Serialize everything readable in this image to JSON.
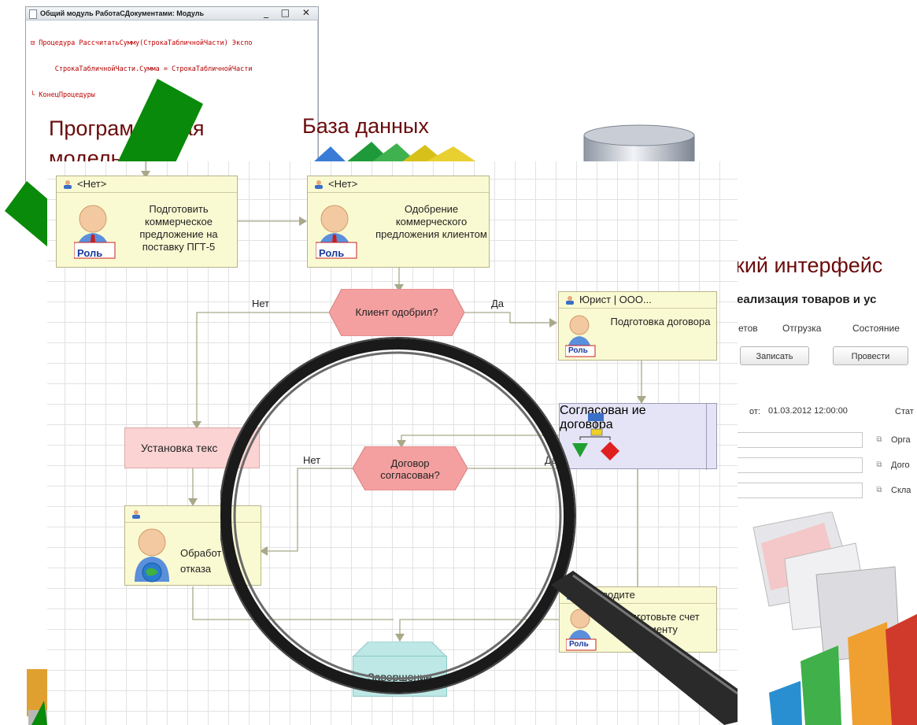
{
  "code_window": {
    "title": "Общий модуль РаботаСДокументами: Модуль",
    "window_buttons": "_ □ ✕",
    "lines": [
      "⊟ Процедура РассчитатьСумму(СтрокаТабличнойЧасти) Экспо",
      "      СтрокаТабличнойЧасти.Сумма = СтрокаТабличнойЧасти",
      "└ КонецПроцедуры"
    ]
  },
  "labels": {
    "program_model_1": "Програм",
    "program_model_2": "ая",
    "program_model_3": "модель",
    "database": "База данных",
    "user_interface": "кий интерфейс"
  },
  "diagram": {
    "node_nobody_1": {
      "header": "<Нет>",
      "text": "Подготовить коммерческое предложение на поставку ПГТ-5"
    },
    "node_nobody_2": {
      "header": "<Нет>",
      "text": "Одобрение коммерческого предложения клиентом"
    },
    "node_lawyer": {
      "header": "Юрист | ООО...",
      "text": "Подготовка договора"
    },
    "node_refusal": {
      "header": "",
      "text": "Обработ отказа"
    },
    "node_manager": {
      "header": "Руководите",
      "text": "Подготовьте счет клиенту"
    },
    "decision_client": "Клиент одобрил?",
    "decision_contract": "Договор согласован?",
    "subprocess": "Согласован ие договора",
    "task_text": "Установка текс",
    "end": "Завершение",
    "yes": "Да",
    "no": "Нет",
    "role_badge": "Роль"
  },
  "form": {
    "title": "еализация товаров и ус",
    "tabs": [
      "етов",
      "Отгрузка",
      "Состояние"
    ],
    "write_button": "Записать",
    "post_button": "Провести",
    "date_prefix": "от:",
    "date_value": "01.03.2012 12:00:00",
    "status_label": "Стат",
    "org_label": "Орга",
    "contract_label": "Дого",
    "warehouse_label": "Скла"
  },
  "colors": {
    "label_color": "#6b0c0c",
    "node_fill": "#fafad2",
    "decision_fill": "#f4a0a0",
    "green_shape": "#0a8a0a"
  }
}
